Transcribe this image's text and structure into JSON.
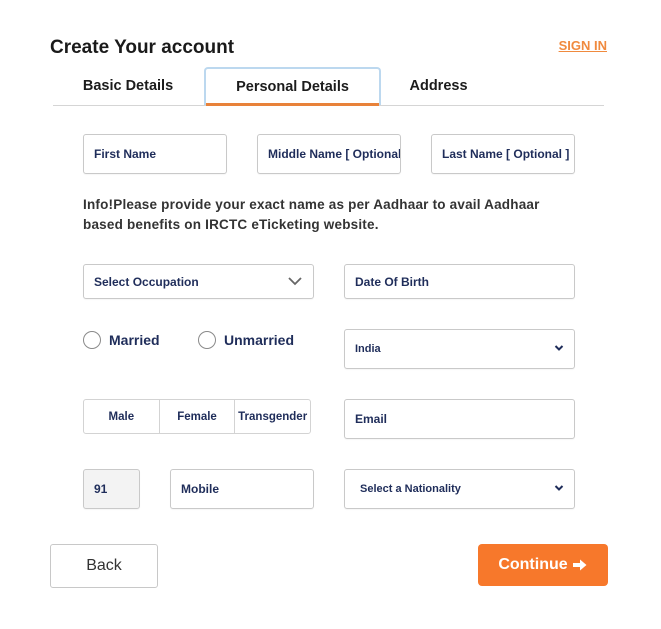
{
  "header": {
    "title": "Create Your account",
    "sign_in": "SIGN IN"
  },
  "tabs": [
    {
      "label": "Basic Details",
      "active": false
    },
    {
      "label": "Personal Details",
      "active": true
    },
    {
      "label": "Address",
      "active": false
    }
  ],
  "names": {
    "first": "First Name",
    "middle": "Middle Name  [ Optional ]",
    "last": "Last Name  [ Optional ]"
  },
  "info_text": "Info!Please provide your exact name as per Aadhaar to avail Aadhaar based benefits on IRCTC eTicketing website.",
  "occupation": {
    "selected": "Select Occupation"
  },
  "dob": {
    "placeholder": "Date Of Birth"
  },
  "marital": [
    {
      "label": "Married"
    },
    {
      "label": "Unmarried"
    }
  ],
  "country": {
    "selected": "India"
  },
  "gender": [
    {
      "label": "Male"
    },
    {
      "label": "Female"
    },
    {
      "label": "Transgender"
    }
  ],
  "email": {
    "placeholder": "Email"
  },
  "phone": {
    "code": "91",
    "placeholder": "Mobile"
  },
  "nationality": {
    "selected": "Select a Nationality"
  },
  "actions": {
    "back": "Back",
    "continue": "Continue",
    "continue_icon": "arrow-right"
  },
  "colors": {
    "accent": "#f7782b",
    "tab_underline": "#e8823a",
    "label_text": "#1f2d5a"
  }
}
